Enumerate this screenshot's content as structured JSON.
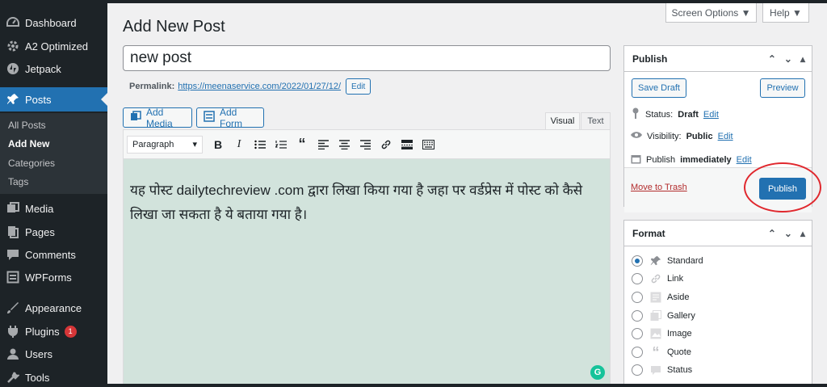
{
  "sidebar": {
    "items": [
      {
        "label": "Dashboard",
        "icon": "dashboard-icon"
      },
      {
        "label": "A2 Optimized",
        "icon": "gear-icon"
      },
      {
        "label": "Jetpack",
        "icon": "jetpack-icon"
      },
      {
        "label": "Posts",
        "icon": "pin-icon",
        "active": true
      },
      {
        "label": "Media",
        "icon": "media-icon"
      },
      {
        "label": "Pages",
        "icon": "pages-icon"
      },
      {
        "label": "Comments",
        "icon": "comments-icon"
      },
      {
        "label": "WPForms",
        "icon": "wpforms-icon"
      },
      {
        "label": "Appearance",
        "icon": "appearance-icon"
      },
      {
        "label": "Plugins",
        "icon": "plugins-icon",
        "badge": "1"
      },
      {
        "label": "Users",
        "icon": "users-icon"
      },
      {
        "label": "Tools",
        "icon": "tools-icon"
      }
    ],
    "submenu": [
      "All Posts",
      "Add New",
      "Categories",
      "Tags"
    ]
  },
  "header": {
    "title": "Add New Post",
    "screen_options": "Screen Options ▼",
    "help": "Help ▼"
  },
  "post": {
    "title_value": "new post",
    "permalink_label": "Permalink:",
    "permalink_url": "https://meenaservice.com/2022/01/27/12/",
    "edit_label": "Edit",
    "content": "यह पोस्ट dailytechreview .com द्वारा लिखा किया गया है जहा पर वर्डप्रेस में पोस्ट को कैसे लिखा जा सकता है ये बताया गया है।"
  },
  "editor": {
    "add_media": "Add Media",
    "add_form": "Add Form",
    "tab_visual": "Visual",
    "tab_text": "Text",
    "format_select": "Paragraph"
  },
  "publish_box": {
    "title": "Publish",
    "save_draft": "Save Draft",
    "preview": "Preview",
    "status_label": "Status:",
    "status_value": "Draft",
    "visibility_label": "Visibility:",
    "visibility_value": "Public",
    "publish_label": "Publish",
    "publish_value": "immediately",
    "edit": "Edit",
    "move_to_trash": "Move to Trash",
    "publish_button": "Publish"
  },
  "format_box": {
    "title": "Format",
    "options": [
      "Standard",
      "Link",
      "Aside",
      "Gallery",
      "Image",
      "Quote",
      "Status"
    ],
    "selected": "Standard"
  },
  "colors": {
    "sidebar": "#1d2327",
    "accent": "#2271b1",
    "editor_bg": "#d2e3dc",
    "highlight_ring": "#e0282e"
  }
}
